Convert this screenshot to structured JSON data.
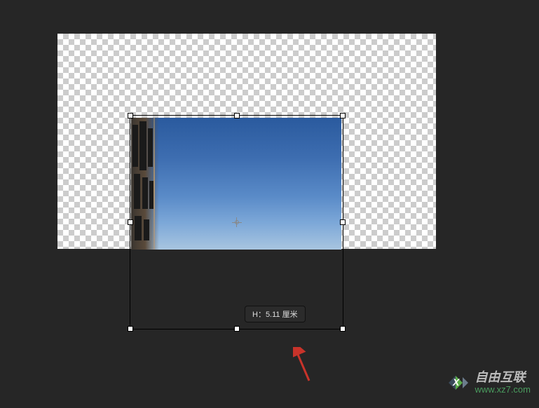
{
  "canvas": {
    "has_transparency": true
  },
  "transform": {
    "dimension_label": "H：5.11 厘米",
    "center_visible": true
  },
  "annotation": {
    "arrow_color": "#c8332a"
  },
  "watermark": {
    "title": "自由互联",
    "url": "www.xz7.com",
    "logo_bg": "#3a4a5a",
    "logo_accent": "#5aad4a"
  }
}
